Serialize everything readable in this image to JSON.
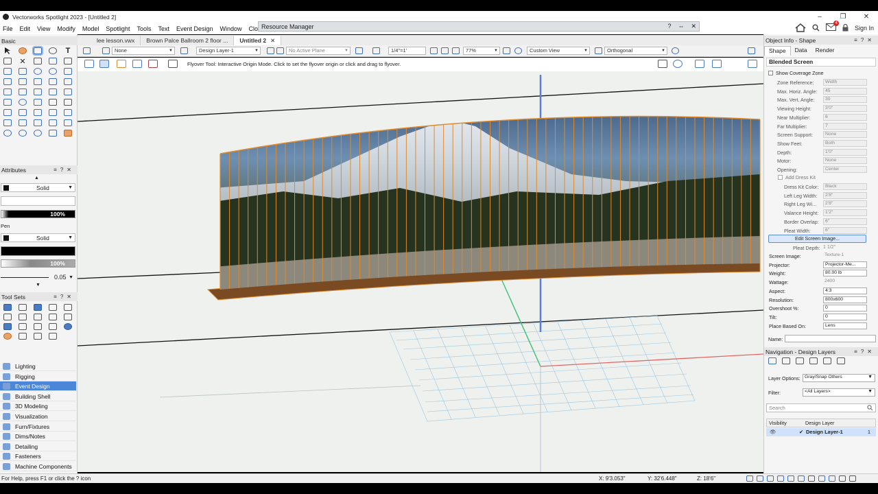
{
  "window": {
    "title": "Vectorworks Spotlight 2023 - [Untitled 2]",
    "controls": [
      "–",
      "❐",
      "✕"
    ]
  },
  "menu": [
    "File",
    "Edit",
    "View",
    "Modify",
    "Model",
    "Spotlight",
    "Tools",
    "Text",
    "Event Design",
    "Window",
    "Cloud",
    "H"
  ],
  "menu_right": {
    "sign_in": "Sign In",
    "notif_count": "4"
  },
  "resource_manager": {
    "title": "Resource Manager",
    "controls": [
      "?",
      "⇔",
      "✕"
    ]
  },
  "basic_palette": {
    "title": "Basic"
  },
  "attributes": {
    "title": "Attributes",
    "fill_style": "Solid",
    "fill_opacity": "100%",
    "pen_label": "Pen",
    "pen_style": "Solid",
    "pen_opacity": "100%",
    "line_weight": "0.05"
  },
  "tool_sets": {
    "title": "Tool Sets",
    "items": [
      "Lighting",
      "Rigging",
      "Event Design",
      "Building Shell",
      "3D Modeling",
      "Visualization",
      "Furn/Fixtures",
      "Dims/Notes",
      "Detailing",
      "Fasteners",
      "Machine Components"
    ],
    "active": "Event Design"
  },
  "tabs": [
    "lee lesson.vwx",
    "Brown Palce Ballroom 2 floor ...",
    "Untitled 2"
  ],
  "view_bar": {
    "class": "None",
    "layer": "Design Layer-1",
    "plane": "No Active Plane",
    "scale": "1/4\"=1'",
    "zoom": "77%",
    "view": "Custom View",
    "projection": "Orthogonal"
  },
  "mode_bar": {
    "hint": "Flyover Tool: Interactive Origin Mode. Click to set the flyover origin or click and drag to flyover."
  },
  "object_info": {
    "title": "Object Info - Shape",
    "tabs": [
      "Shape",
      "Data",
      "Render"
    ],
    "object_type": "Blended Screen",
    "show_coverage": "Show Coverage Zone",
    "fields": [
      {
        "label": "Zone Reference:",
        "value": "Width",
        "enabled": false
      },
      {
        "label": "Max. Horiz. Angle:",
        "value": "45",
        "enabled": false
      },
      {
        "label": "Max. Vert. Angle:",
        "value": "30",
        "enabled": false
      },
      {
        "label": "Viewing Height:",
        "value": "3'0\"",
        "enabled": false
      },
      {
        "label": "Near Multiplier:",
        "value": "6",
        "enabled": false
      },
      {
        "label": "Far Multiplier:",
        "value": "7",
        "enabled": false
      },
      {
        "label": "Screen Support:",
        "value": "None",
        "enabled": false
      },
      {
        "label": "Show Feet:",
        "value": "Both",
        "enabled": false
      },
      {
        "label": "Depth:",
        "value": "1'0\"",
        "enabled": false
      },
      {
        "label": "Motor:",
        "value": "None",
        "enabled": false
      },
      {
        "label": "Opening:",
        "value": "Center",
        "enabled": false
      }
    ],
    "add_dress_kit": "Add Dress Kit",
    "dress_fields": [
      {
        "label": "Dress Kit Color:",
        "value": "Black"
      },
      {
        "label": "Left Leg Width:",
        "value": "2'8\""
      },
      {
        "label": "Right Leg Wi...",
        "value": "2'8\""
      },
      {
        "label": "Valance Height:",
        "value": "1'2\""
      },
      {
        "label": "Border Overlap:",
        "value": "6\""
      },
      {
        "label": "Pleat Width:",
        "value": "6\""
      }
    ],
    "edit_button": "Edit Screen Image...",
    "pleat_depth": {
      "label": "Pleat Depth:",
      "value": "1 1/2\""
    },
    "active_fields": [
      {
        "label": "Screen Image:",
        "value": "Texture-1",
        "input": false
      },
      {
        "label": "Projector:",
        "value": "Projector-Me...",
        "input": true
      },
      {
        "label": "Weight:",
        "value": "80.00 lb",
        "input": true
      },
      {
        "label": "Wattage:",
        "value": "2400",
        "input": false
      },
      {
        "label": "Aspect:",
        "value": "4:3",
        "input": true
      },
      {
        "label": "Resolution:",
        "value": "800x600",
        "input": true
      },
      {
        "label": "Overshoot %:",
        "value": "0",
        "input": true
      },
      {
        "label": "Tilt:",
        "value": "0",
        "input": true
      },
      {
        "label": "Place Based On:",
        "value": "Lens",
        "input": true
      }
    ],
    "name_label": "Name:"
  },
  "navigation": {
    "title": "Navigation - Design Layers",
    "layer_options_label": "Layer Options:",
    "layer_options": "Gray/Snap Others",
    "filter_label": "Filter:",
    "filter": "<All Layers>",
    "search_placeholder": "Search",
    "col_visibility": "Visibility",
    "col_layer": "Design Layer",
    "row_layer": "Design Layer-1",
    "row_num": "1"
  },
  "status": {
    "help": "For Help, press F1 or click the ? icon",
    "x": "X: 9'3.053\"",
    "y": "Y: 32'6.448\"",
    "z": "Z: 18'6\""
  },
  "colors": {
    "accent": "#4b86d8",
    "orange": "#e08a2c",
    "menubg": "#ffffff"
  }
}
